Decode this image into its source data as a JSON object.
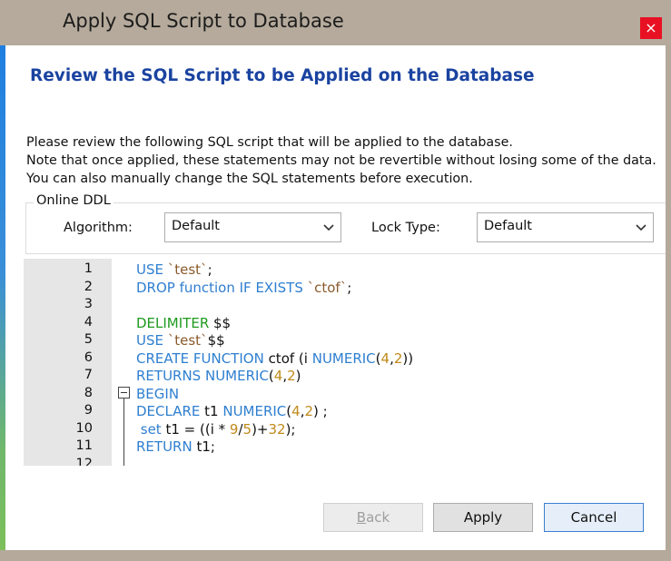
{
  "window": {
    "title": "Apply SQL Script to Database",
    "close_glyph": "×"
  },
  "header": {
    "title": "Review the SQL Script to be Applied on the Database"
  },
  "description": {
    "line1": "Please review the following SQL script that will be applied to the database.",
    "line2": "Note that once applied, these statements may not be revertible without losing some of the data.",
    "line3": "You can also manually change the SQL statements before execution."
  },
  "online_ddl": {
    "group_label": "Online DDL",
    "algorithm_label": "Algorithm:",
    "algorithm_value": "Default",
    "lock_type_label": "Lock Type:",
    "lock_type_value": "Default"
  },
  "editor": {
    "line_numbers": [
      "1",
      "2",
      "3",
      "4",
      "5",
      "6",
      "7",
      "8",
      "9",
      "10",
      "11",
      "12"
    ],
    "lines": [
      [
        {
          "t": "USE ",
          "c": "kw"
        },
        {
          "t": "`test`",
          "c": "str"
        },
        {
          "t": ";",
          "c": ""
        }
      ],
      [
        {
          "t": "DROP function IF EXISTS ",
          "c": "kw"
        },
        {
          "t": "`ctof`",
          "c": "str"
        },
        {
          "t": ";",
          "c": ""
        }
      ],
      [],
      [
        {
          "t": "DELIMITER ",
          "c": "dl"
        },
        {
          "t": "$$",
          "c": ""
        }
      ],
      [
        {
          "t": "USE ",
          "c": "kw"
        },
        {
          "t": "`test`",
          "c": "str"
        },
        {
          "t": "$$",
          "c": ""
        }
      ],
      [
        {
          "t": "CREATE FUNCTION ",
          "c": "kw"
        },
        {
          "t": "ctof (i ",
          "c": ""
        },
        {
          "t": "NUMERIC",
          "c": "kw"
        },
        {
          "t": "(",
          "c": ""
        },
        {
          "t": "4",
          "c": "num"
        },
        {
          "t": ",",
          "c": ""
        },
        {
          "t": "2",
          "c": "num"
        },
        {
          "t": "))",
          "c": ""
        }
      ],
      [
        {
          "t": "RETURNS NUMERIC",
          "c": "kw"
        },
        {
          "t": "(",
          "c": ""
        },
        {
          "t": "4",
          "c": "num"
        },
        {
          "t": ",",
          "c": ""
        },
        {
          "t": "2",
          "c": "num"
        },
        {
          "t": ")",
          "c": ""
        }
      ],
      [
        {
          "t": "BEGIN",
          "c": "kw"
        }
      ],
      [
        {
          "t": "DECLARE ",
          "c": "kw"
        },
        {
          "t": "t1 ",
          "c": ""
        },
        {
          "t": "NUMERIC",
          "c": "kw"
        },
        {
          "t": "(",
          "c": ""
        },
        {
          "t": "4",
          "c": "num"
        },
        {
          "t": ",",
          "c": ""
        },
        {
          "t": "2",
          "c": "num"
        },
        {
          "t": ") ;",
          "c": ""
        }
      ],
      [
        {
          "t": " set ",
          "c": "kw"
        },
        {
          "t": "t1 = ((i * ",
          "c": ""
        },
        {
          "t": "9",
          "c": "num"
        },
        {
          "t": "/",
          "c": ""
        },
        {
          "t": "5",
          "c": "num"
        },
        {
          "t": ")+",
          "c": ""
        },
        {
          "t": "32",
          "c": "num"
        },
        {
          "t": ");",
          "c": ""
        }
      ],
      [
        {
          "t": "RETURN ",
          "c": "kw"
        },
        {
          "t": "t1;",
          "c": ""
        }
      ],
      []
    ]
  },
  "buttons": {
    "back": {
      "prefix": "",
      "mnemonic": "B",
      "suffix": "ack"
    },
    "apply": "Apply",
    "cancel": "Cancel"
  }
}
